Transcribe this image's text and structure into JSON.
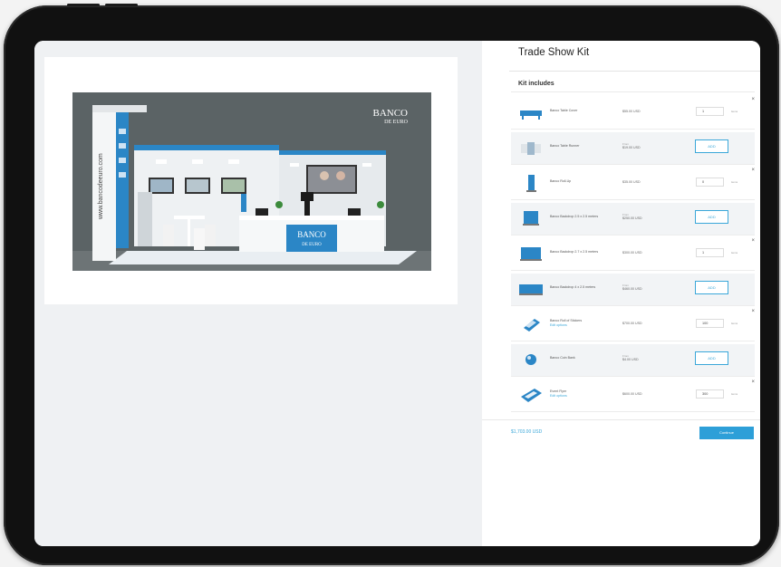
{
  "panel": {
    "title": "Trade Show Kit",
    "subtitle": "Kit includes"
  },
  "booth": {
    "brand_line1": "BANCO",
    "brand_line2": "DE EURO",
    "desk_line1": "BANCO",
    "desk_line2": "DE EURO",
    "website": "www.bancodeeuro.com"
  },
  "items": [
    {
      "name": "Banco Table Cover",
      "price": "$55.00 USD",
      "qty": "1",
      "unit": "items",
      "thumb": "table-cover-icon"
    },
    {
      "name": "Banco Table Runner",
      "from": "From",
      "price": "$19.00 USD",
      "add": "ADD",
      "thumb": "table-runner-icon"
    },
    {
      "name": "Banco Roll-Up",
      "price": "$35.00 USD",
      "qty": "0",
      "unit": "items",
      "thumb": "roll-up-banner-icon"
    },
    {
      "name": "Banco Backdrop 2.5 x 2.5 meters",
      "from": "From",
      "price": "$250.00 USD",
      "add": "ADD",
      "thumb": "backdrop-icon"
    },
    {
      "name": "Banco Backdrop 2.7 x 2.5 meters",
      "price": "$300.00 USD",
      "qty": "1",
      "unit": "items",
      "thumb": "backdrop-wide-icon"
    },
    {
      "name": "Banco Backdrop 4 x 2.5 meters",
      "from": "From",
      "price": "$460.00 USD",
      "add": "ADD",
      "thumb": "backdrop-large-icon"
    },
    {
      "name": "Banco Roll of Stickers",
      "link": "Edit options",
      "price": "$700.00 USD",
      "qty": "100",
      "unit": "items",
      "thumb": "stickers-icon"
    },
    {
      "name": "Banco Coin Bank",
      "from": "From",
      "price": "$4.00 USD",
      "add": "ADD",
      "thumb": "coin-bank-icon"
    },
    {
      "name": "Event Flyer",
      "link": "Edit options",
      "price": "$600.00 USD",
      "qty": "300",
      "unit": "items",
      "thumb": "flyer-icon"
    }
  ],
  "footer": {
    "total": "$1,703.00 USD",
    "continue_label": "Continue"
  },
  "colors": {
    "accent": "#2d9fd8",
    "booth_wall": "#5b6365",
    "booth_blue": "#2b86c6"
  }
}
